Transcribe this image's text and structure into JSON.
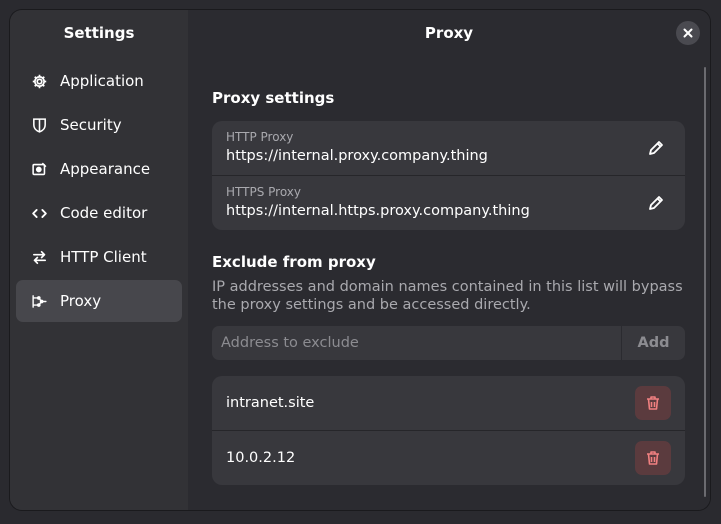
{
  "sidebar": {
    "title": "Settings",
    "items": [
      {
        "label": "Application",
        "icon": "gear-icon"
      },
      {
        "label": "Security",
        "icon": "shield-icon"
      },
      {
        "label": "Appearance",
        "icon": "appearance-icon"
      },
      {
        "label": "Code editor",
        "icon": "code-icon"
      },
      {
        "label": "HTTP Client",
        "icon": "arrows-swap-icon"
      },
      {
        "label": "Proxy",
        "icon": "proxy-icon",
        "active": true
      }
    ]
  },
  "header": {
    "title": "Proxy"
  },
  "proxy_settings": {
    "title": "Proxy settings",
    "http": {
      "label": "HTTP Proxy",
      "value": "https://internal.proxy.company.thing"
    },
    "https": {
      "label": "HTTPS Proxy",
      "value": "https://internal.https.proxy.company.thing"
    }
  },
  "exclude": {
    "title": "Exclude from proxy",
    "description": "IP addresses and domain names contained in this list will bypass the proxy settings and be accessed directly.",
    "input_placeholder": "Address to exclude",
    "input_value": "",
    "add_label": "Add",
    "items": [
      "intranet.site",
      "10.0.2.12"
    ]
  },
  "colors": {
    "sidebar_bg": "#323236",
    "content_bg": "#2b2b30",
    "card_bg": "#38383d",
    "active_item_bg": "#47474c",
    "delete_bg": "#5b3b3e",
    "delete_icon": "#f08080"
  }
}
